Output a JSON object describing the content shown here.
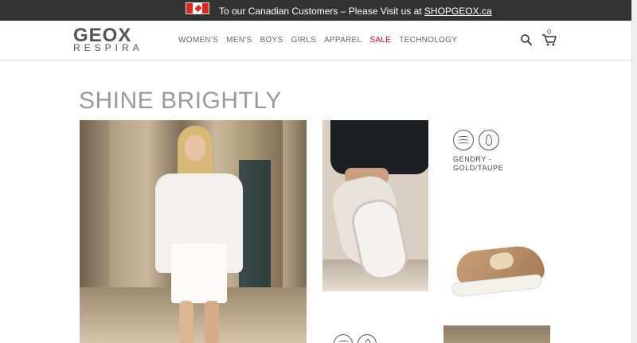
{
  "colors": {
    "topbar_bg": "#333333",
    "sale": "#d0021b",
    "headline": "#9a9a9a"
  },
  "topbar": {
    "flag_icon": "canada-flag-icon",
    "promo_text": "To our Canadian Customers – Please Visit us at",
    "promo_link": "SHOPGEOX.ca"
  },
  "header": {
    "logo_main": "GEOX",
    "logo_sub": "RESPIRA",
    "nav": [
      "WOMEN'S",
      "MEN'S",
      "BOYS",
      "GIRLS",
      "APPAREL",
      "SALE",
      "TECHNOLOGY"
    ],
    "search_icon": "search-icon",
    "cart_icon": "cart-icon",
    "cart_count": "0"
  },
  "main": {
    "headline": "SHINE BRIGHTLY",
    "product": {
      "name_line1": "GENDRY -",
      "name_line2": "GOLD/TAUPE",
      "feature_icons": [
        "breathable-waves-icon",
        "leaf-icon"
      ]
    },
    "bottom_feature_icons": [
      "breathable-waves-icon",
      "leaf-icon"
    ]
  }
}
